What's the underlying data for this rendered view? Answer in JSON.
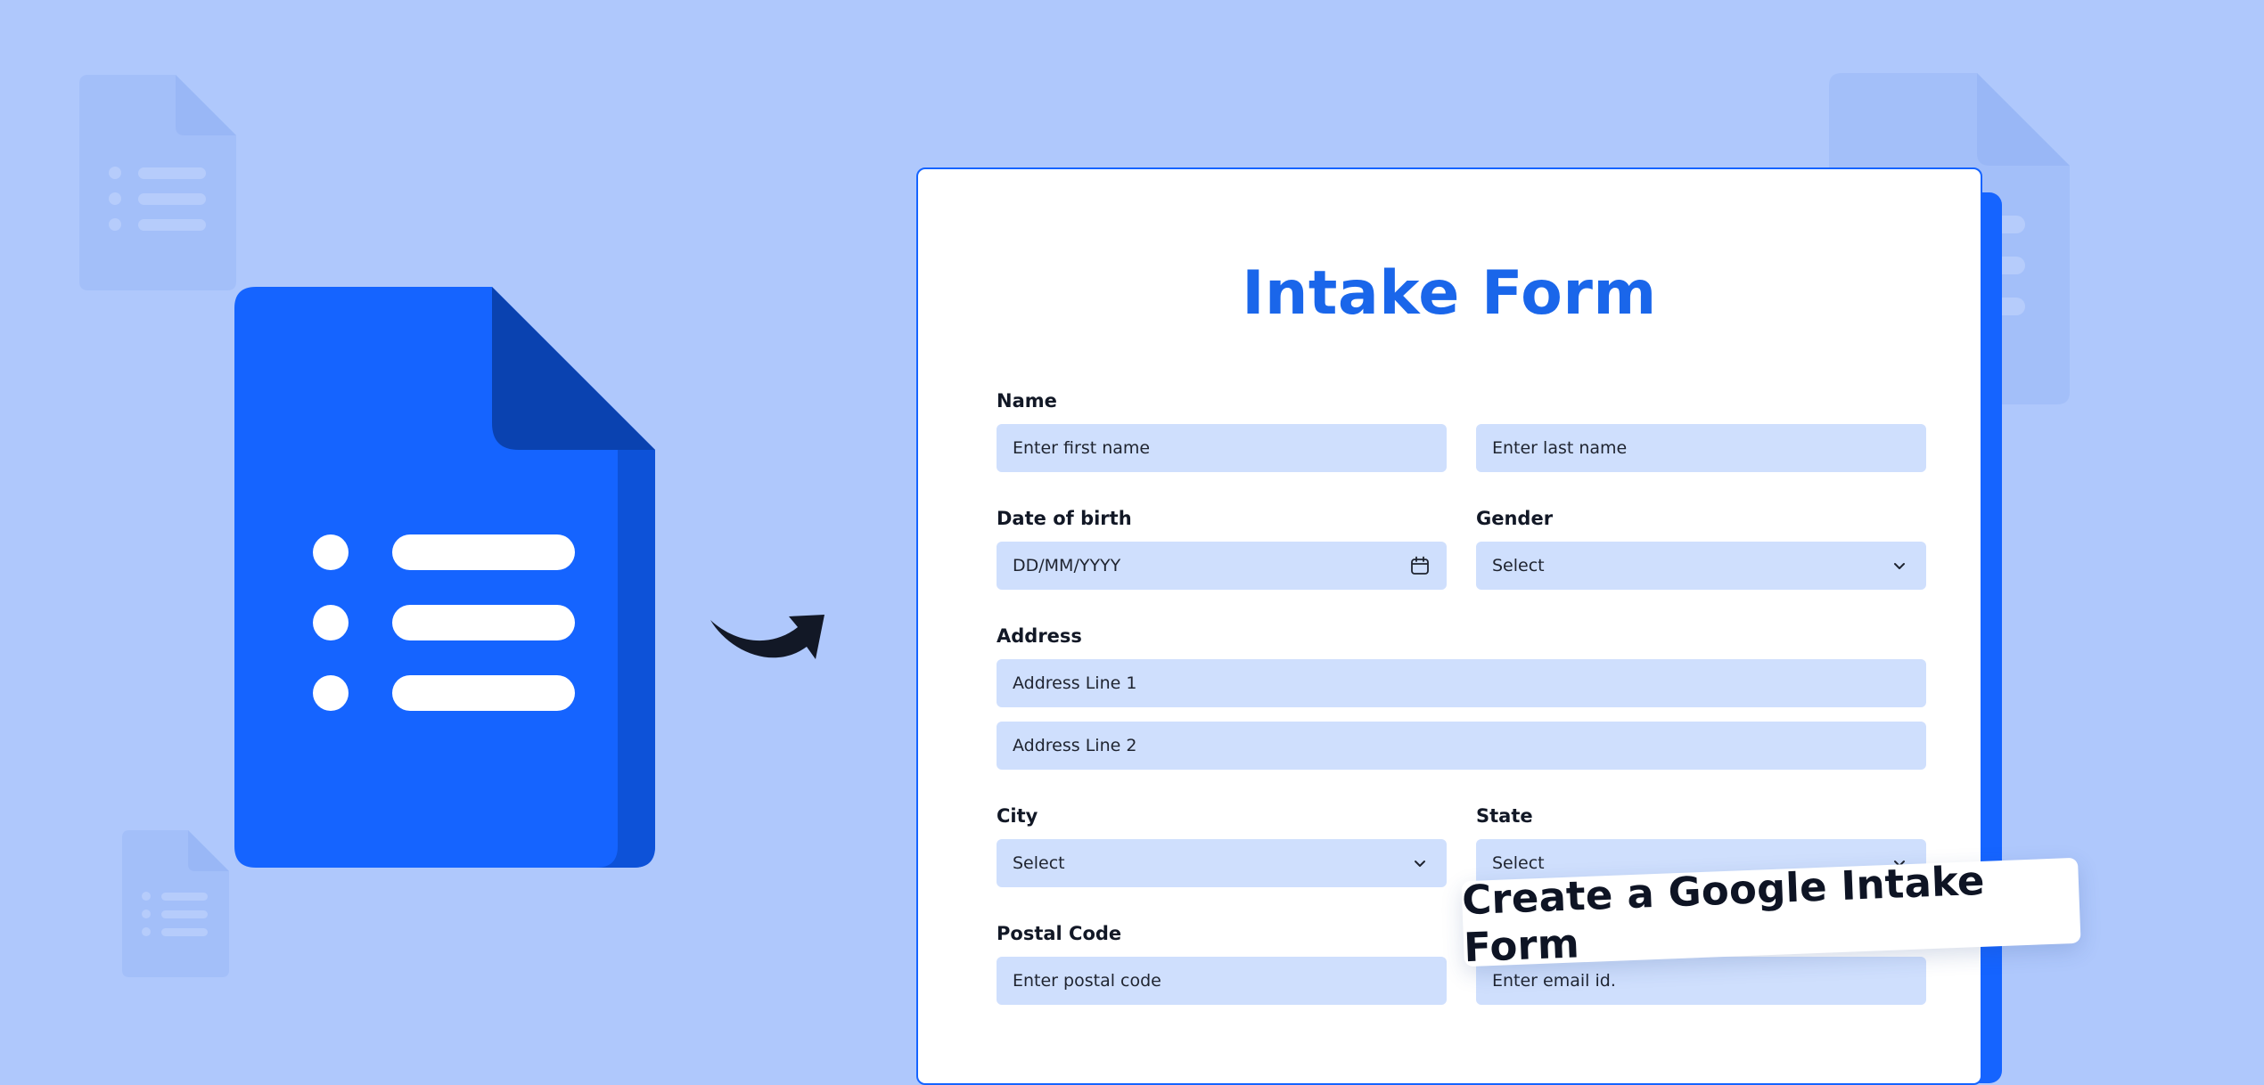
{
  "colors": {
    "background": "#afc8fc",
    "brand_blue": "#1564ff",
    "doc_fold": "#0a42b0",
    "field_bg": "#cfdffd",
    "title_blue": "#1a66ea"
  },
  "form": {
    "title": "Intake Form",
    "name": {
      "label": "Name",
      "first_placeholder": "Enter first name",
      "last_placeholder": "Enter last name"
    },
    "dob": {
      "label": "Date of birth",
      "placeholder": "DD/MM/YYYY",
      "icon": "calendar-icon"
    },
    "gender": {
      "label": "Gender",
      "selected": "Select",
      "icon": "chevron-down-icon"
    },
    "address": {
      "label": "Address",
      "line1_placeholder": "Address Line 1",
      "line2_placeholder": "Address Line 2"
    },
    "city": {
      "label": "City",
      "selected": "Select"
    },
    "state": {
      "label": "State",
      "selected": "Select"
    },
    "postal": {
      "label": "Postal Code",
      "placeholder": "Enter postal code"
    },
    "email": {
      "placeholder": "Enter email id."
    }
  },
  "banner": {
    "text": "Create a Google Intake Form"
  },
  "icons": {
    "main": "google-forms-doc-icon",
    "arrow": "curved-arrow-icon",
    "ghosts": "faint-doc-icon"
  }
}
